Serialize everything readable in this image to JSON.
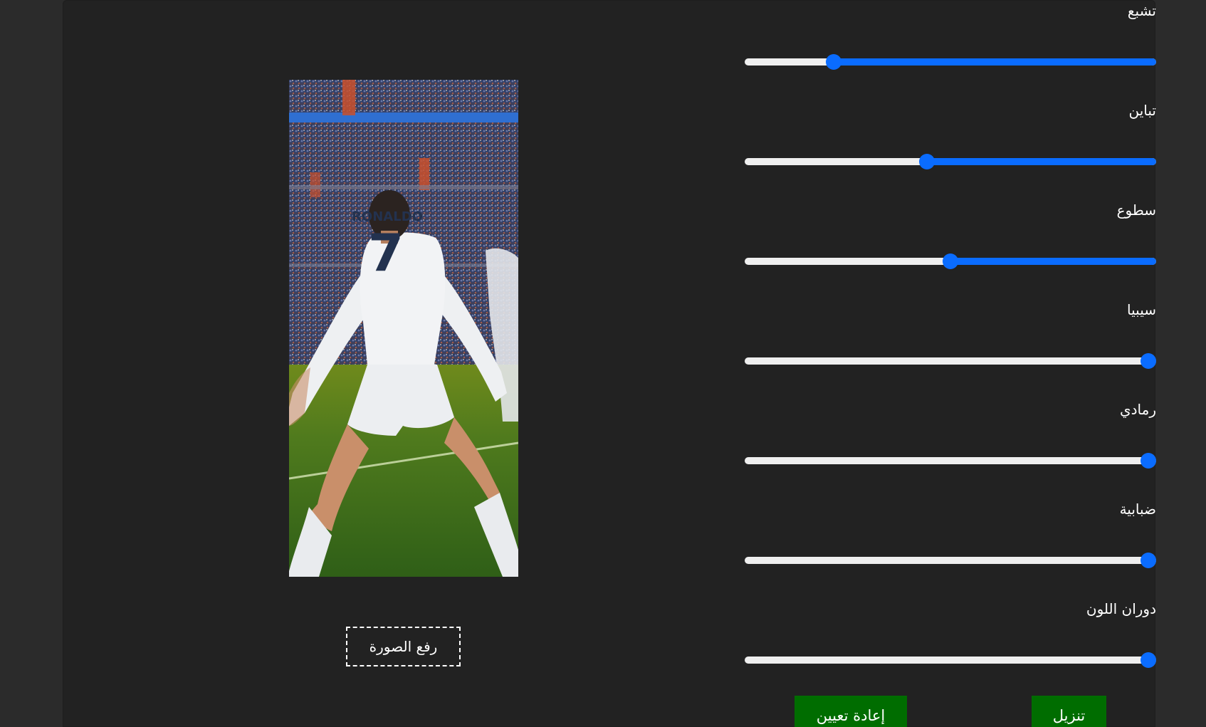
{
  "preview": {
    "jersey_name": "RONALDO",
    "jersey_number": "7"
  },
  "upload": {
    "label": "رفع الصورة"
  },
  "filters": [
    {
      "key": "saturate",
      "label": "تشبع",
      "fraction": 0.205
    },
    {
      "key": "contrast",
      "label": "تباين",
      "fraction": 0.44
    },
    {
      "key": "brightness",
      "label": "سطوع",
      "fraction": 0.5
    },
    {
      "key": "sepia",
      "label": "سيبيا",
      "fraction": 1.0
    },
    {
      "key": "grayscale",
      "label": "رمادي",
      "fraction": 1.0
    },
    {
      "key": "blur",
      "label": "ضبابية",
      "fraction": 1.0
    },
    {
      "key": "hue_rotate",
      "label": "دوران اللون",
      "fraction": 1.0
    }
  ],
  "actions": {
    "reset_label": "إعادة تعيين",
    "download_label": "تنزيل"
  },
  "colors": {
    "background": "#2b2b2b",
    "panel": "#222222",
    "accent": "#0a6cff",
    "track": "#efefef",
    "action_button": "#006d00"
  }
}
